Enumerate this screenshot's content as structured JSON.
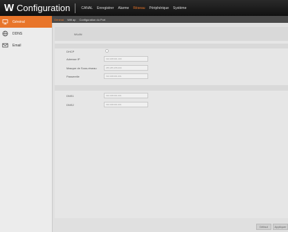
{
  "app": {
    "title": "Configuration",
    "menu": [
      "CANAL",
      "Enregistrer",
      "Alarme",
      "Réseau",
      "Périphérique",
      "Système"
    ],
    "active_menu": "Réseau"
  },
  "sidebar": {
    "items": [
      {
        "label": "Général",
        "icon": "monitor-icon",
        "active": true
      },
      {
        "label": "DDNS",
        "icon": "globe-icon",
        "active": false
      },
      {
        "label": "Email",
        "icon": "mail-icon",
        "active": false
      }
    ]
  },
  "subtabs": [
    "Général",
    "Wifi ap",
    "Configuration du Port"
  ],
  "form": {
    "wlan_label": "WLAN",
    "dhcp_label": "DHCP",
    "ip_label": "Adresse IP",
    "mask_label": "Masque de Sous-réseau",
    "gateway_label": "Passerelle",
    "dns1_label": "DNS1",
    "dns2_label": "DNS2",
    "ip_value": "192.168.001.100",
    "mask_value": "255.255.255.000",
    "gateway_value": "192.168.001.001",
    "dns1_value": "192.168.001.001",
    "dns2_value": "192.168.001.001"
  },
  "footer": {
    "default_label": "Défaut",
    "apply_label": "Appliquer"
  },
  "colors": {
    "accent": "#e8752a",
    "topbar": "#1a1a1a",
    "sidebar": "#ececec"
  }
}
